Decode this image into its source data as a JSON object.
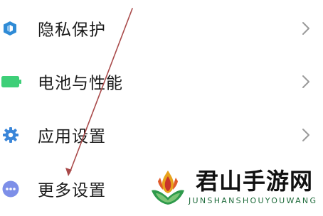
{
  "settings": {
    "items": [
      {
        "label": "隐私保护",
        "icon": "privacy-shield-icon",
        "icon_color": "#2f8bd6",
        "has_chevron": true
      },
      {
        "label": "电池与性能",
        "icon": "battery-icon",
        "icon_color": "#3ecf78",
        "has_chevron": true
      },
      {
        "label": "应用设置",
        "icon": "gear-icon",
        "icon_color": "#3a86d9",
        "has_chevron": true
      },
      {
        "label": "更多设置",
        "icon": "more-dots-icon",
        "icon_color": "#7d8fe8",
        "has_chevron": false
      }
    ]
  },
  "annotation": {
    "arrow_color": "#a94a4a"
  },
  "watermark": {
    "title": "君山手游网",
    "subtitle": "JUNSHANSHOUYOUWANG"
  }
}
